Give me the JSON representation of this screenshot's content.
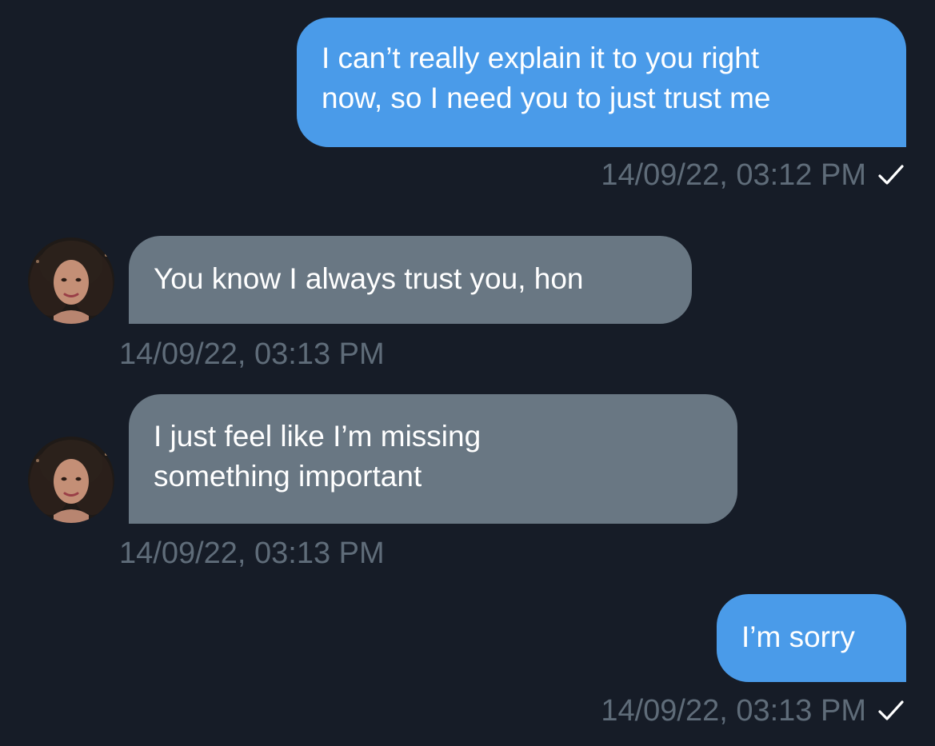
{
  "messages": [
    {
      "direction": "outgoing",
      "text": "I can’t really explain it to you right\nnow, so I need you to just trust me",
      "timestamp": "14/09/22, 03:12 PM",
      "status_icon": "check-icon"
    },
    {
      "direction": "incoming",
      "text": "You know I always trust you, hon",
      "timestamp": "14/09/22, 03:13 PM",
      "avatar": "contact-avatar"
    },
    {
      "direction": "incoming",
      "text": "I just feel like I’m missing\nsomething important",
      "timestamp": "14/09/22, 03:13 PM",
      "avatar": "contact-avatar"
    },
    {
      "direction": "outgoing",
      "text": "I’m sorry",
      "timestamp": "14/09/22, 03:13 PM",
      "status_icon": "check-icon"
    }
  ],
  "colors": {
    "background": "#161c27",
    "outgoing_bubble": "#4a9be9",
    "incoming_bubble": "#697783",
    "timestamp": "#5f6c79",
    "text": "#ffffff"
  }
}
